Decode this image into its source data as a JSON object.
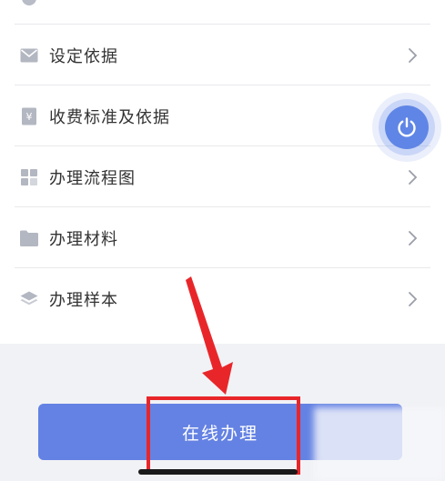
{
  "list": {
    "items": [
      {
        "label": "设定依据",
        "icon": "envelope-icon"
      },
      {
        "label": "收费标准及依据",
        "icon": "yen-icon"
      },
      {
        "label": "办理流程图",
        "icon": "grid-icon"
      },
      {
        "label": "办理材料",
        "icon": "folder-icon"
      },
      {
        "label": "办理样本",
        "icon": "layers-icon"
      }
    ]
  },
  "fab": {
    "icon": "power-icon"
  },
  "footer": {
    "online_handle_label": "在线办理"
  },
  "colors": {
    "accent": "#6482e3",
    "annotation": "#e8262a",
    "background_gray": "#f1f2f5"
  }
}
